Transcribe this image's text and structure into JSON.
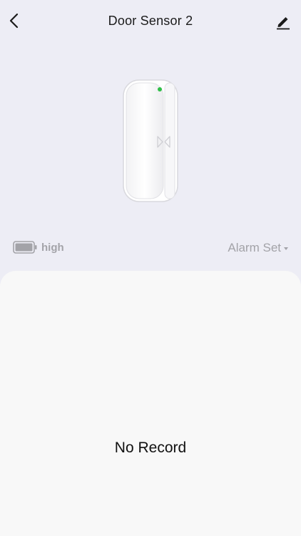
{
  "header": {
    "title": "Door Sensor 2",
    "back_icon": "chevron-left-icon",
    "edit_icon": "pencil-icon"
  },
  "device": {
    "status_led_color": "#2fbf47"
  },
  "status": {
    "battery_level": "high",
    "battery_icon": "battery-icon",
    "alarm_label": "Alarm Set",
    "alarm_caret_icon": "caret-down-icon"
  },
  "records": {
    "empty_message": "No Record"
  },
  "colors": {
    "background": "#ededf5",
    "panel": "#f8f8f8",
    "muted_text": "#a3a3a8"
  }
}
